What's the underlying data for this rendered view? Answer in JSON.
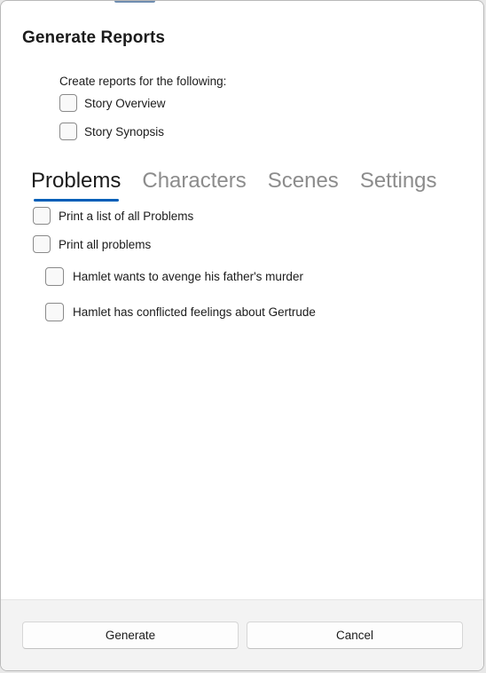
{
  "dialog": {
    "title": "Generate Reports",
    "intro": "Create reports for the following:"
  },
  "story_options": [
    {
      "label": "Story Overview",
      "checked": false
    },
    {
      "label": "Story Synopsis",
      "checked": false
    }
  ],
  "tabs": [
    {
      "label": "Problems",
      "active": true
    },
    {
      "label": "Characters",
      "active": false
    },
    {
      "label": "Scenes",
      "active": false
    },
    {
      "label": "Settings",
      "active": false
    }
  ],
  "problems": {
    "print_list_label": "Print a list of all Problems",
    "print_all_label": "Print all problems",
    "items": [
      {
        "label": "Hamlet wants to avenge his father's murder",
        "checked": false
      },
      {
        "label": "Hamlet has conflicted feelings about Gertrude",
        "checked": false
      }
    ]
  },
  "footer": {
    "generate_label": "Generate",
    "cancel_label": "Cancel"
  },
  "colors": {
    "accent": "#005fb8",
    "inactive_tab": "#8c8c8c",
    "footer_bg": "#f3f3f3"
  }
}
